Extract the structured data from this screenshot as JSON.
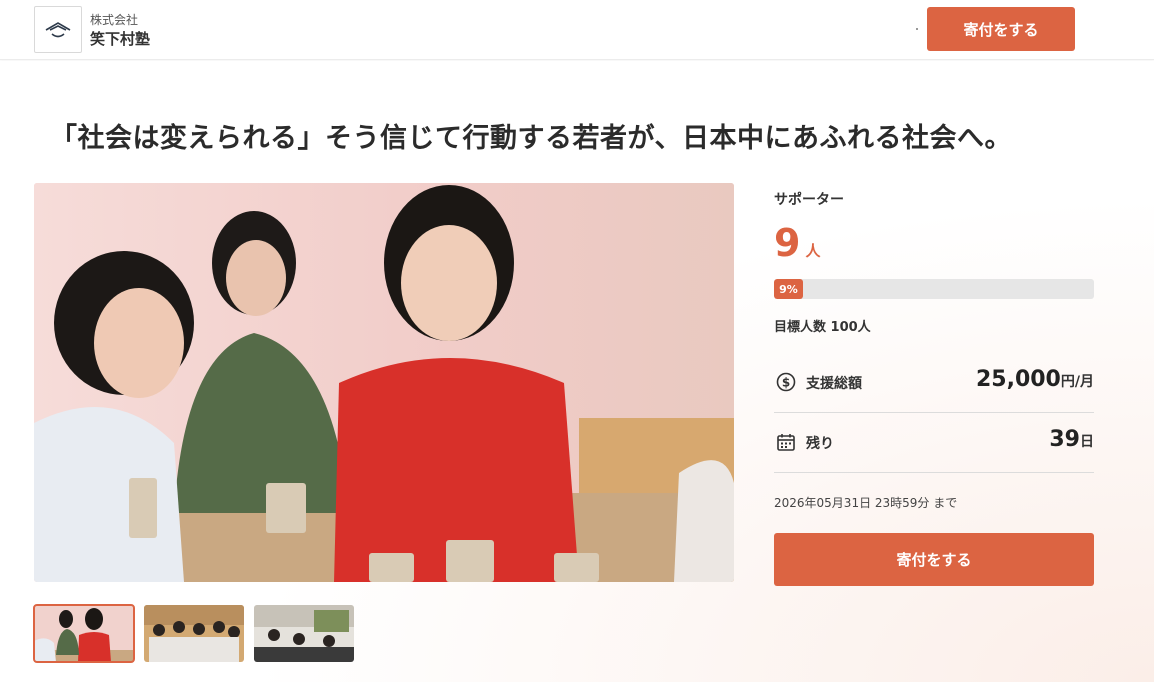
{
  "header": {
    "org_type": "株式会社",
    "org_name": "笑下村塾",
    "donate_label": "寄付をする"
  },
  "headline": "「社会は変えられる」そう信じて行動する若者が、日本中にあふれる社会へ。",
  "thumbnails": [
    {
      "label": "thumbnail 1",
      "active": true
    },
    {
      "label": "thumbnail 2",
      "active": false
    },
    {
      "label": "thumbnail 3",
      "active": false
    }
  ],
  "stats": {
    "supporters_label": "サポーター",
    "supporters_count": "9",
    "supporters_unit": "人",
    "progress_percent": 9,
    "progress_label": "9%",
    "goal_text": "目標人数 100人",
    "amount_label": "支援総額",
    "amount_value": "25,000",
    "amount_unit": "円/月",
    "remaining_label": "残り",
    "remaining_value": "39",
    "remaining_unit": "日",
    "deadline_text": "2026年05月31日 23時59分 まで",
    "donate_label": "寄付をする"
  },
  "colors": {
    "accent": "#dc6442",
    "track": "#e6e6e6"
  },
  "icons": {
    "logo": "mountain-logo-icon",
    "amount": "dollar-circle-icon",
    "remaining": "calendar-icon"
  }
}
